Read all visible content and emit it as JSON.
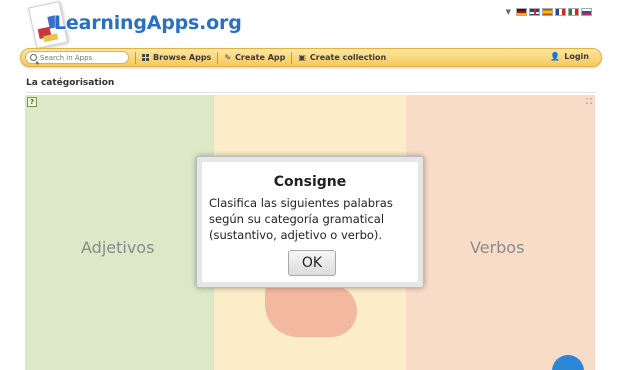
{
  "header": {
    "logo_text": "LearningApps.org",
    "languages": [
      "de",
      "en",
      "es",
      "fr",
      "it",
      "ru"
    ]
  },
  "nav": {
    "search_placeholder": "Search in Apps",
    "browse_label": "Browse Apps",
    "create_app_label": "Create App",
    "create_collection_label": "Create collection",
    "login_label": "Login"
  },
  "page": {
    "title": "La catégorisation"
  },
  "app": {
    "categories": [
      "Adjetivos",
      "Verbos"
    ],
    "colors": {
      "left": "#dce8c8",
      "middle": "#fbedc8",
      "right": "#f9dcc8"
    }
  },
  "dialog": {
    "title": "Consigne",
    "text": "Clasifica las siguientes palabras según su categoría gramatical (sustantivo, adjetivo o verbo).",
    "ok_label": "OK"
  },
  "colors": {
    "accent": "#2b6fc2",
    "nav_bg": "#f6c95a"
  }
}
